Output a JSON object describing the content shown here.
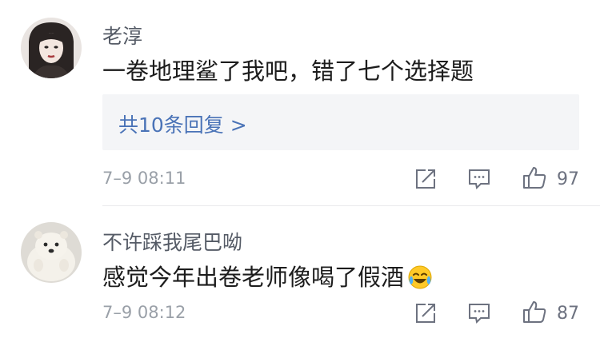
{
  "comments": [
    {
      "username": "老淳",
      "text": "一卷地理鲨了我吧，错了七个选择题",
      "reply_link": "共10条回复 >",
      "time": "7–9 08:11",
      "likes": "97"
    },
    {
      "username": "不许踩我尾巴呦",
      "text": "感觉今年出卷老师像喝了假酒",
      "emoji": "laughing-crying-emoji",
      "time": "7–9 08:12",
      "likes": "87"
    }
  ],
  "icons": {
    "share": "share-icon",
    "comment": "comment-icon",
    "like": "thumbs-up-icon"
  },
  "colors": {
    "username": "#555b66",
    "link": "#4a73b7",
    "meta": "#9aa0a8",
    "reply_bg": "#f4f5f7"
  }
}
